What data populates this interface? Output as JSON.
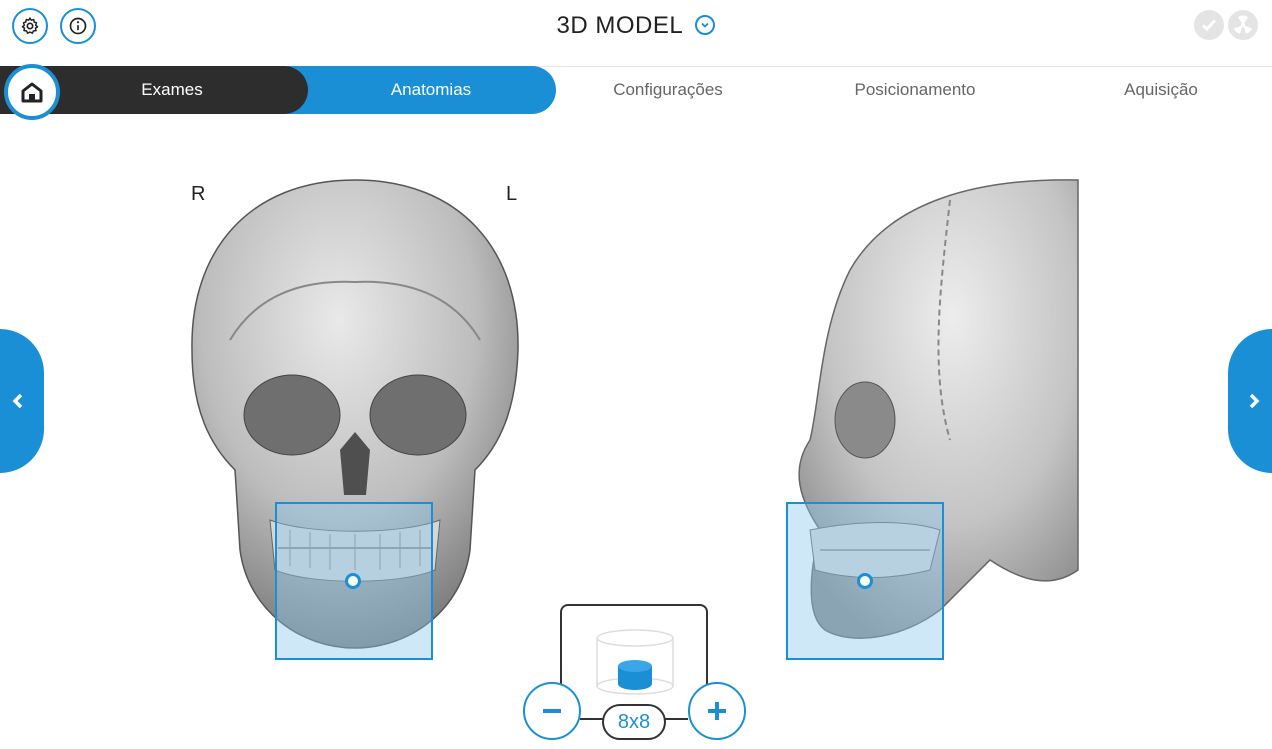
{
  "header": {
    "title": "3D MODEL",
    "settings_icon": "gear-icon",
    "info_icon": "info-icon",
    "dropdown_icon": "chevron-down-icon",
    "status_icons": [
      "check-circle-icon",
      "radiation-icon"
    ]
  },
  "nav": {
    "home_icon": "home-icon",
    "tabs": [
      {
        "label": "Exames",
        "state": "done"
      },
      {
        "label": "Anatomias",
        "state": "active"
      },
      {
        "label": "Configurações",
        "state": "pending"
      },
      {
        "label": "Posicionamento",
        "state": "pending"
      },
      {
        "label": "Aquisição",
        "state": "pending"
      }
    ]
  },
  "viewer": {
    "label_right": "R",
    "label_left": "L",
    "prev_icon": "chevron-left-icon",
    "next_icon": "chevron-right-icon"
  },
  "fov": {
    "size": "8x8",
    "minus_icon": "minus-icon",
    "plus_icon": "plus-icon",
    "cylinder_icon": "volume-cylinder-icon"
  },
  "colors": {
    "accent": "#1a8fd6",
    "dark": "#2d2d2d",
    "selection": "#8cc8eb"
  }
}
